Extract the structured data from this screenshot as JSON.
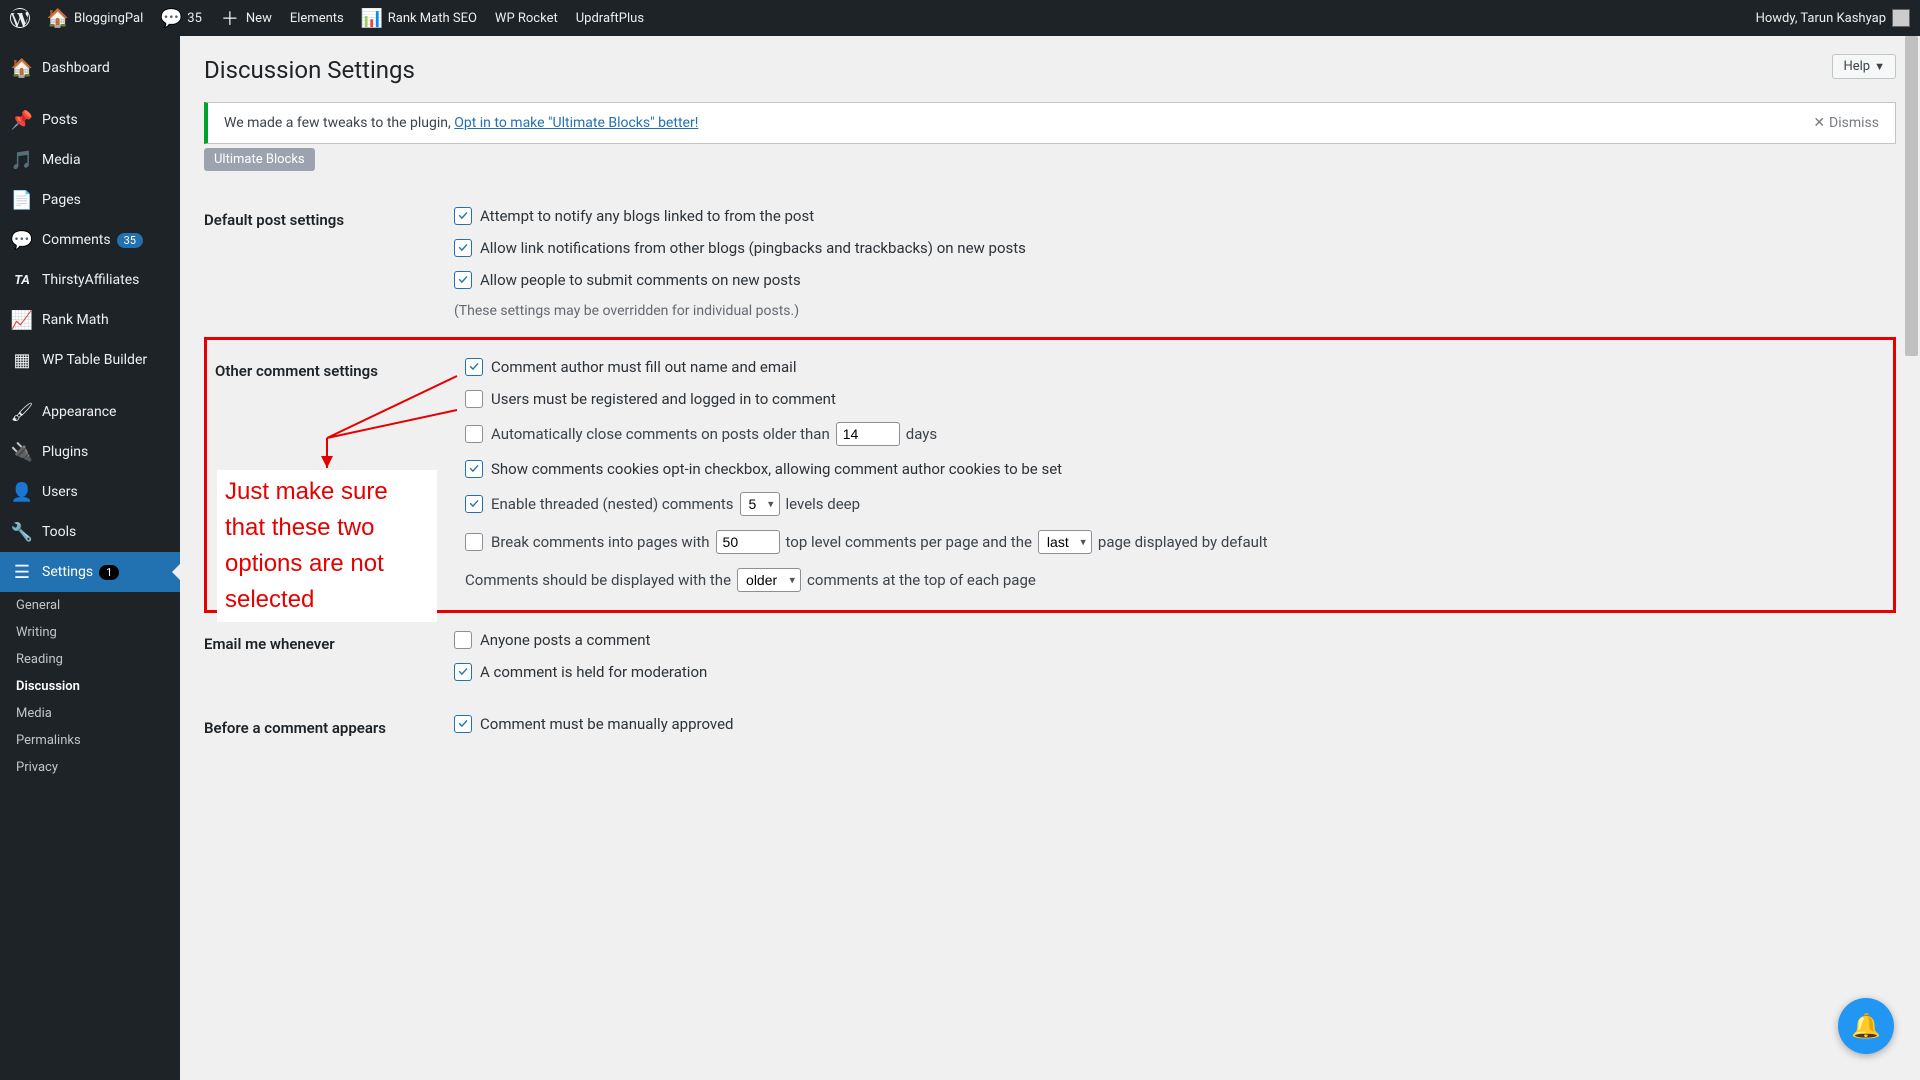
{
  "adminbar": {
    "site_name": "BloggingPal",
    "comments_count": "35",
    "new_label": "New",
    "items": [
      "Elements",
      "Rank Math SEO",
      "WP Rocket",
      "UpdraftPlus"
    ],
    "howdy": "Howdy, Tarun Kashyap"
  },
  "sidebar": {
    "dashboard": "Dashboard",
    "posts": "Posts",
    "media": "Media",
    "pages": "Pages",
    "comments": "Comments",
    "comments_badge": "35",
    "thirsty": "ThirstyAffiliates",
    "rankmath": "Rank Math",
    "wptable": "WP Table Builder",
    "appearance": "Appearance",
    "plugins": "Plugins",
    "users": "Users",
    "tools": "Tools",
    "settings": "Settings",
    "settings_badge": "1",
    "sub": [
      "General",
      "Writing",
      "Reading",
      "Discussion",
      "Media",
      "Permalinks",
      "Privacy"
    ]
  },
  "page": {
    "help": "Help",
    "title": "Discussion Settings",
    "notice_text": "We made a few tweaks to the plugin, ",
    "notice_link": "Opt in to make \"Ultimate Blocks\" better!",
    "dismiss": "Dismiss",
    "tag": "Ultimate Blocks"
  },
  "sec1": {
    "heading": "Default post settings",
    "o1": "Attempt to notify any blogs linked to from the post",
    "o2": "Allow link notifications from other blogs (pingbacks and trackbacks) on new posts",
    "o3": "Allow people to submit comments on new posts",
    "note": "(These settings may be overridden for individual posts.)"
  },
  "sec2": {
    "heading": "Other comment settings",
    "o1": "Comment author must fill out name and email",
    "o2": "Users must be registered and logged in to comment",
    "o3a": "Automatically close comments on posts older than",
    "o3val": "14",
    "o3b": "days",
    "o4": "Show comments cookies opt-in checkbox, allowing comment author cookies to be set",
    "o5a": "Enable threaded (nested) comments",
    "o5val": "5",
    "o5b": "levels deep",
    "o6a": "Break comments into pages with",
    "o6val": "50",
    "o6b": "top level comments per page and the",
    "o6sel": "last",
    "o6c": "page displayed by default",
    "o7a": "Comments should be displayed with the",
    "o7sel": "older",
    "o7b": "comments at the top of each page"
  },
  "sec3": {
    "heading": "Email me whenever",
    "o1": "Anyone posts a comment",
    "o2": "A comment is held for moderation"
  },
  "sec4": {
    "heading": "Before a comment appears",
    "o1": "Comment must be manually approved"
  },
  "annotation": "Just make sure that these two options are not selected"
}
